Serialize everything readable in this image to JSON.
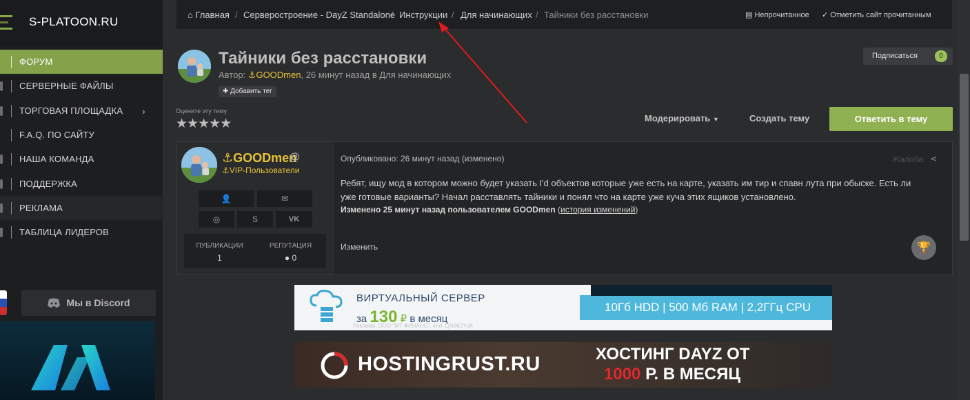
{
  "site": {
    "name": "S-PLATOON.RU"
  },
  "sidebar": {
    "items": [
      {
        "label": "ФОРУМ"
      },
      {
        "label": "СЕРВЕРНЫЕ ФАЙЛЫ"
      },
      {
        "label": "ТОРГОВАЯ ПЛОЩАДКА"
      },
      {
        "label": "F.A.Q. ПО САЙТУ"
      },
      {
        "label": "НАША КОМАНДА"
      },
      {
        "label": "ПОДДЕРЖКА"
      },
      {
        "label": "РЕКЛАМА"
      },
      {
        "label": "ТАБЛИЦА ЛИДЕРОВ"
      }
    ],
    "discord_label": "Мы в Discord"
  },
  "breadcrumb": {
    "items": [
      "Главная",
      "Серверостроение - DayZ Standalone",
      "Инструкции",
      "Для начинающих",
      "Тайники без расстановки"
    ],
    "unread": "Непрочитанное",
    "mark_read": "Отметить сайт прочитанным"
  },
  "topic": {
    "title": "Тайники без расстановки",
    "meta_prefix": "Автор:",
    "author": "GOODmen",
    "meta_suffix": ", 26 минут назад в Для начинающих",
    "add_tag": "Добавить тег",
    "rate_label": "Оцените эту тему",
    "stars": "★★★★★",
    "subscribe": "Подписаться",
    "subscribe_count": "0",
    "moderate": "Модерировать",
    "create_topic": "Создать тему",
    "reply": "Ответить в тему"
  },
  "post": {
    "author_name": "GOODmen",
    "author_at": "@",
    "author_group": "VIP-Пользователи",
    "stats": {
      "posts_label": "ПУБЛИКАЦИИ",
      "posts_value": "1",
      "rep_label": "РЕПУТАЦИЯ",
      "rep_value": "0"
    },
    "published": "Опубликовано: 26 минут назад (изменено)",
    "report": "Жалоба",
    "body": "Ребят, ищу мод в котором можно будет указать I'd объектов которые уже есть на карте, указать им тир и спавн лута при обыске. Есть ли уже готовые варианты? Начал расставлять тайники и понял что на карте уже куча этих ящиков установлено.",
    "edited_text": "Изменено 25 минут назад пользователем GOODmen",
    "history_link": "история изменений",
    "edit": "Изменить"
  },
  "ads": {
    "ad1_line1": "ВИРТУАЛЬНЫЙ СЕРВЕР",
    "ad1_pre": "за",
    "ad1_price": "130",
    "ad1_currency": "₽",
    "ad1_post": "в месяц",
    "ad1_strip": "10Гб HDD | 500 Мб RAM | 2,2ГГц CPU",
    "ad1_small": "Реклама. ООО \"МТ ФИНАНС\", erid: LjN8K2YyK",
    "ad2_brand": "HOSTINGRUST.RU",
    "ad2_r1": "ХОСТИНГ DAYZ ОТ",
    "ad2_price": "1000",
    "ad2_r2": "Р. В МЕСЯЦ"
  },
  "colors": {
    "accent": "#8fb152",
    "author": "#e8c23a",
    "sidebar_active": "#83a24a"
  }
}
